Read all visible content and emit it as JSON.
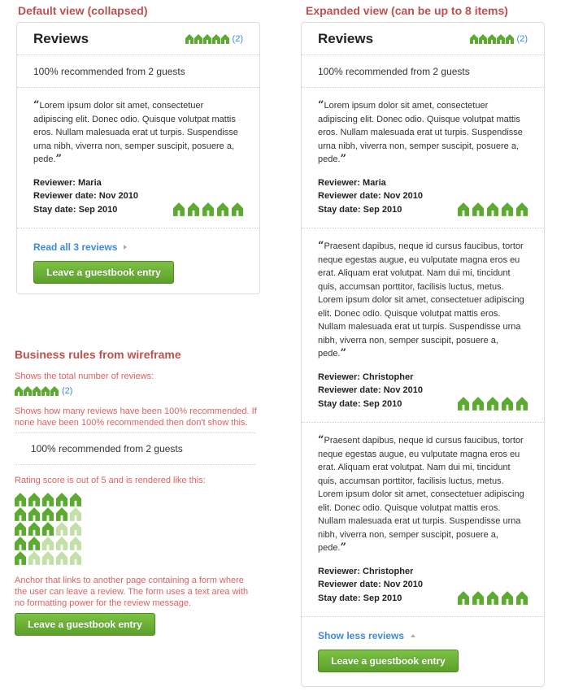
{
  "colors": {
    "heading": "#c0504d",
    "rule_text": "#e06060",
    "link": "#3d8ad6",
    "house_full": "#5aab2f",
    "house_empty": "#c2e0a8",
    "button": "#5ca02b"
  },
  "house_icon": "house-rating-icon",
  "collapsed": {
    "heading": "Default view (collapsed)",
    "title": "Reviews",
    "rating": 5,
    "count": "(2)",
    "recommend": "100% recommended from 2 guests",
    "reviews": [
      {
        "text": "Lorem ipsum dolor sit amet, consectetuer adipiscing elit. Donec odio. Quisque volutpat mattis eros. Nullam malesuada erat ut turpis. Suspendisse urna nibh, viverra non, semper suscipit, posuere a, pede.",
        "reviewer": "Reviewer: Maria",
        "date": "Reviewer date: Nov 2010",
        "stay": "Stay date: Sep 2010",
        "rating": 5
      }
    ],
    "link": "Read all 3 reviews",
    "button": "Leave a guestbook entry"
  },
  "expanded": {
    "heading": "Expanded view (can be up to 8 items)",
    "title": "Reviews",
    "rating": 5,
    "count": "(2)",
    "recommend": "100% recommended from 2 guests",
    "reviews": [
      {
        "text": "Lorem ipsum dolor sit amet, consectetuer adipiscing elit. Donec odio. Quisque volutpat mattis eros. Nullam malesuada erat ut turpis. Suspendisse urna nibh, viverra non, semper suscipit, posuere a, pede.",
        "reviewer": "Reviewer: Maria",
        "date": "Reviewer date: Nov 2010",
        "stay": "Stay date: Sep 2010",
        "rating": 5
      },
      {
        "text": "Praesent dapibus, neque id cursus faucibus, tortor neque egestas augue, eu vulputate magna eros eu erat. Aliquam erat volutpat. Nam dui mi, tincidunt quis, accumsan porttitor, facilisis luctus, metus. Lorem ipsum dolor sit amet, consectetuer adipiscing elit. Donec odio. Quisque volutpat mattis eros. Nullam malesuada erat ut turpis. Suspendisse urna nibh, viverra non, semper suscipit, posuere a, pede.",
        "reviewer": "Reviewer: Christopher",
        "date": "Reviewer date: Nov 2010",
        "stay": "Stay date: Sep 2010",
        "rating": 5
      },
      {
        "text": "Praesent dapibus, neque id cursus faucibus, tortor neque egestas augue, eu vulputate magna eros eu erat. Aliquam erat volutpat. Nam dui mi, tincidunt quis, accumsan porttitor, facilisis luctus, metus. Lorem ipsum dolor sit amet, consectetuer adipiscing elit. Donec odio. Quisque volutpat mattis eros. Nullam malesuada erat ut turpis. Suspendisse urna nibh, viverra non, semper suscipit, posuere a, pede.",
        "reviewer": "Reviewer: Christopher",
        "date": "Reviewer date: Nov 2010",
        "stay": "Stay date: Sep 2010",
        "rating": 5
      }
    ],
    "link": "Show less reviews",
    "button": "Leave a guestbook entry"
  },
  "rules": {
    "heading": "Business rules from wireframe",
    "total_note": "Shows the total number of reviews:",
    "total_rating": 5,
    "total_count": "(2)",
    "recommend_note": "Shows how many reviews have been 100% recommended. If none have been 100% recommended then don't show this.",
    "recommend_example": "100% recommended from 2 guests",
    "rating_note": "Rating score is out of 5 and is rendered like this:",
    "rating_scale": [
      5,
      4,
      3,
      2,
      1
    ],
    "anchor_note": "Anchor that links to another page containing a form where the user can leave a review. The form uses a text area with no formatting power for the review message.",
    "button": "Leave a guestbook entry"
  }
}
